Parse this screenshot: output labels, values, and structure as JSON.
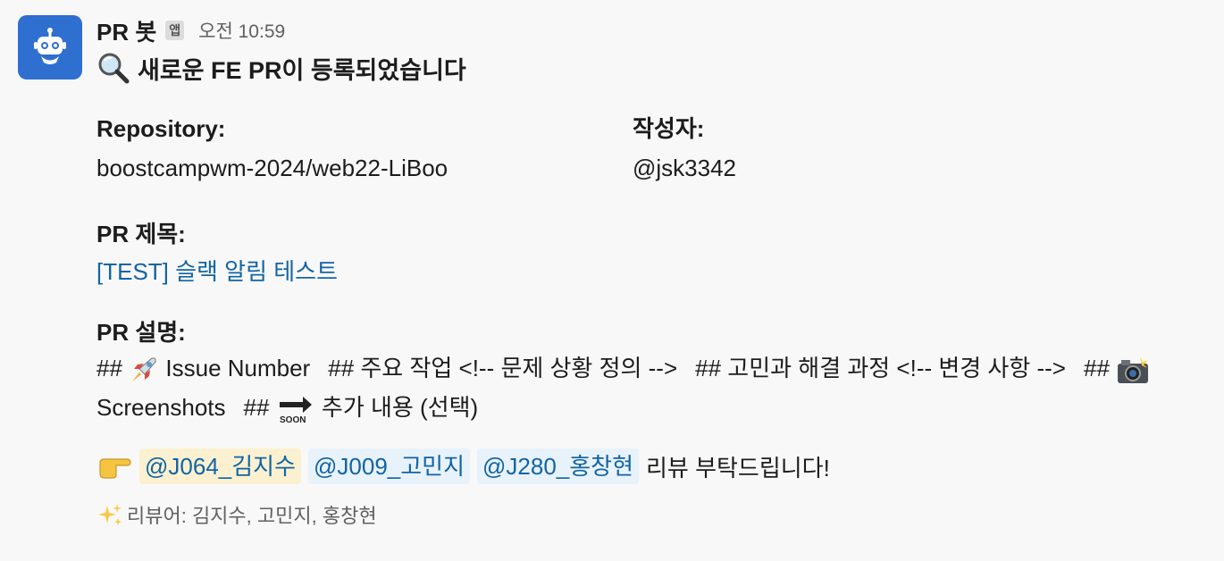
{
  "header": {
    "bot_name": "PR 봇",
    "app_badge": "앱",
    "timestamp": "오전 10:59"
  },
  "title": {
    "icon": "magnifier-emoji",
    "text": "새로운 FE PR이 등록되었습니다"
  },
  "fields": {
    "repository_label": "Repository:",
    "repository_value": "boostcampwm-2024/web22-LiBoo",
    "author_label": "작성자:",
    "author_value": "@jsk3342"
  },
  "pr_title": {
    "label": "PR 제목:",
    "value": "[TEST] 슬랙 알림 테스트"
  },
  "pr_description": {
    "label": "PR 설명:",
    "part1": "## ",
    "part2": " Issue Number",
    "part3": "## 주요 작업 <!-- 문제 상황 정의 -->",
    "part4": "## 고민과 해결 과정 <!-- 변경 사항 -->",
    "part5": "## ",
    "part6": " Screenshots",
    "part7": "## ",
    "part8": " 추가 내용 (선택)"
  },
  "review_request": {
    "mention1": "@J064_김지수",
    "mention2": "@J009_고민지",
    "mention3": "@J280_홍창현",
    "text": "리뷰 부탁드립니다!"
  },
  "reviewers": {
    "text": "리뷰어: 김지수, 고민지, 홍창현"
  },
  "colors": {
    "avatar_bg": "#2f6fcf",
    "link": "#1264a3",
    "mention_highlight_bg": "#fbf1d1",
    "mention_bg": "#e8f2fb"
  }
}
